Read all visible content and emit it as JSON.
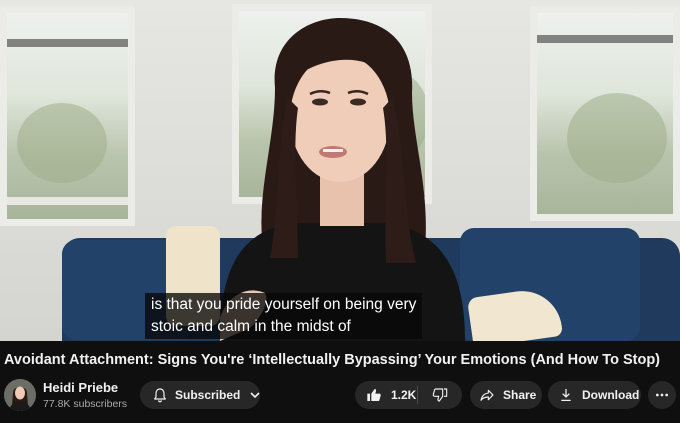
{
  "video": {
    "caption_line1": "is that you pride yourself on being very",
    "caption_line2": "stoic and calm in the midst of"
  },
  "title": "Avoidant Attachment: Signs You're ‘Intellectually Bypassing’ Your Emotions (And How To Stop)",
  "channel": {
    "name": "Heidi Priebe",
    "subscribers": "77.8K subscribers",
    "avatar_icon": "avatar"
  },
  "actions": {
    "subscribe_label": "Subscribed",
    "subscribe_icon": "bell-icon",
    "like_count": "1.2K",
    "like_icon": "thumbs-up-icon",
    "dislike_icon": "thumbs-down-icon",
    "share_label": "Share",
    "share_icon": "share-icon",
    "download_label": "Download",
    "download_icon": "download-icon",
    "more_icon": "more-horizontal-icon"
  },
  "colors": {
    "background": "#0f0f0f",
    "button": "#272727",
    "text": "#f1f1f1",
    "secondary_text": "#aaaaaa"
  }
}
